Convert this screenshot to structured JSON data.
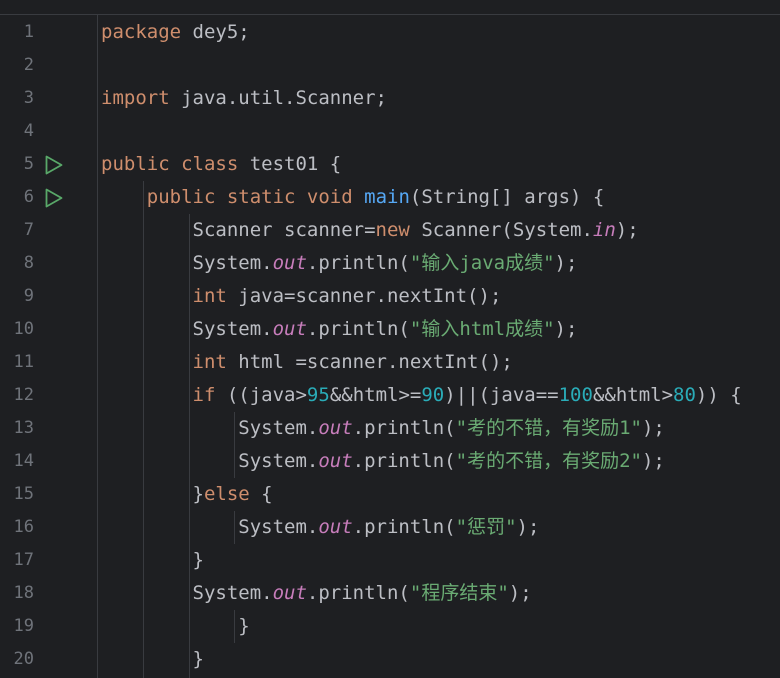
{
  "editor": {
    "theme": {
      "background": "#1e1f22",
      "keyword": "#cf8e6d",
      "method": "#56a8f5",
      "field": "#c77dbb",
      "string": "#6aab73",
      "number": "#2aacb8",
      "plain": "#bcbec4",
      "line_number": "#6f737a",
      "run_gutter": "#59a869"
    },
    "gutter_icons": [
      {
        "line": 5,
        "icon": "run-icon"
      },
      {
        "line": 6,
        "icon": "run-icon"
      }
    ],
    "lines": [
      {
        "number": "1",
        "tokens": [
          {
            "t": "kw",
            "v": "package"
          },
          {
            "t": "pl",
            "v": " dey5;"
          }
        ]
      },
      {
        "number": "2",
        "tokens": []
      },
      {
        "number": "3",
        "tokens": [
          {
            "t": "kw",
            "v": "import"
          },
          {
            "t": "pl",
            "v": " java.util.Scanner;"
          }
        ]
      },
      {
        "number": "4",
        "tokens": []
      },
      {
        "number": "5",
        "tokens": [
          {
            "t": "kw",
            "v": "public class"
          },
          {
            "t": "pl",
            "v": " test01 {"
          }
        ]
      },
      {
        "number": "6",
        "tokens": [
          {
            "t": "pl",
            "v": "    "
          },
          {
            "t": "kw",
            "v": "public static void"
          },
          {
            "t": "pl",
            "v": " "
          },
          {
            "t": "fn",
            "v": "main"
          },
          {
            "t": "pl",
            "v": "(String[] args) {"
          }
        ]
      },
      {
        "number": "7",
        "tokens": [
          {
            "t": "pl",
            "v": "        Scanner scanner="
          },
          {
            "t": "kw",
            "v": "new"
          },
          {
            "t": "pl",
            "v": " Scanner(System."
          },
          {
            "t": "fld",
            "v": "in"
          },
          {
            "t": "pl",
            "v": ");"
          }
        ]
      },
      {
        "number": "8",
        "tokens": [
          {
            "t": "pl",
            "v": "        System."
          },
          {
            "t": "fld",
            "v": "out"
          },
          {
            "t": "pl",
            "v": ".println("
          },
          {
            "t": "str",
            "v": "\"输入java成绩\""
          },
          {
            "t": "pl",
            "v": ");"
          }
        ]
      },
      {
        "number": "9",
        "tokens": [
          {
            "t": "pl",
            "v": "        "
          },
          {
            "t": "kw",
            "v": "int"
          },
          {
            "t": "pl",
            "v": " java=scanner.nextInt();"
          }
        ]
      },
      {
        "number": "10",
        "tokens": [
          {
            "t": "pl",
            "v": "        System."
          },
          {
            "t": "fld",
            "v": "out"
          },
          {
            "t": "pl",
            "v": ".println("
          },
          {
            "t": "str",
            "v": "\"输入html成绩\""
          },
          {
            "t": "pl",
            "v": ");"
          }
        ]
      },
      {
        "number": "11",
        "tokens": [
          {
            "t": "pl",
            "v": "        "
          },
          {
            "t": "kw",
            "v": "int"
          },
          {
            "t": "pl",
            "v": " html =scanner.nextInt();"
          }
        ]
      },
      {
        "number": "12",
        "tokens": [
          {
            "t": "pl",
            "v": "        "
          },
          {
            "t": "kw",
            "v": "if"
          },
          {
            "t": "pl",
            "v": " ((java>"
          },
          {
            "t": "num",
            "v": "95"
          },
          {
            "t": "pl",
            "v": "&&html>="
          },
          {
            "t": "num",
            "v": "90"
          },
          {
            "t": "pl",
            "v": ")||(java=="
          },
          {
            "t": "num",
            "v": "100"
          },
          {
            "t": "pl",
            "v": "&&html>"
          },
          {
            "t": "num",
            "v": "80"
          },
          {
            "t": "pl",
            "v": ")) {"
          }
        ]
      },
      {
        "number": "13",
        "tokens": [
          {
            "t": "pl",
            "v": "            System."
          },
          {
            "t": "fld",
            "v": "out"
          },
          {
            "t": "pl",
            "v": ".println("
          },
          {
            "t": "str",
            "v": "\"考的不错，有奖励1\""
          },
          {
            "t": "pl",
            "v": ");"
          }
        ]
      },
      {
        "number": "14",
        "tokens": [
          {
            "t": "pl",
            "v": "            System."
          },
          {
            "t": "fld",
            "v": "out"
          },
          {
            "t": "pl",
            "v": ".println("
          },
          {
            "t": "str",
            "v": "\"考的不错，有奖励2\""
          },
          {
            "t": "pl",
            "v": ");"
          }
        ]
      },
      {
        "number": "15",
        "tokens": [
          {
            "t": "pl",
            "v": "        }"
          },
          {
            "t": "kw",
            "v": "else"
          },
          {
            "t": "pl",
            "v": " {"
          }
        ]
      },
      {
        "number": "16",
        "tokens": [
          {
            "t": "pl",
            "v": "            System."
          },
          {
            "t": "fld",
            "v": "out"
          },
          {
            "t": "pl",
            "v": ".println("
          },
          {
            "t": "str",
            "v": "\"惩罚\""
          },
          {
            "t": "pl",
            "v": ");"
          }
        ]
      },
      {
        "number": "17",
        "tokens": [
          {
            "t": "pl",
            "v": "        }"
          }
        ]
      },
      {
        "number": "18",
        "tokens": [
          {
            "t": "pl",
            "v": "        System."
          },
          {
            "t": "fld",
            "v": "out"
          },
          {
            "t": "pl",
            "v": ".println("
          },
          {
            "t": "str",
            "v": "\"程序结束\""
          },
          {
            "t": "pl",
            "v": ");"
          }
        ]
      },
      {
        "number": "19",
        "tokens": [
          {
            "t": "pl",
            "v": "            }"
          }
        ]
      },
      {
        "number": "20",
        "tokens": [
          {
            "t": "pl",
            "v": "        }"
          }
        ]
      }
    ]
  }
}
